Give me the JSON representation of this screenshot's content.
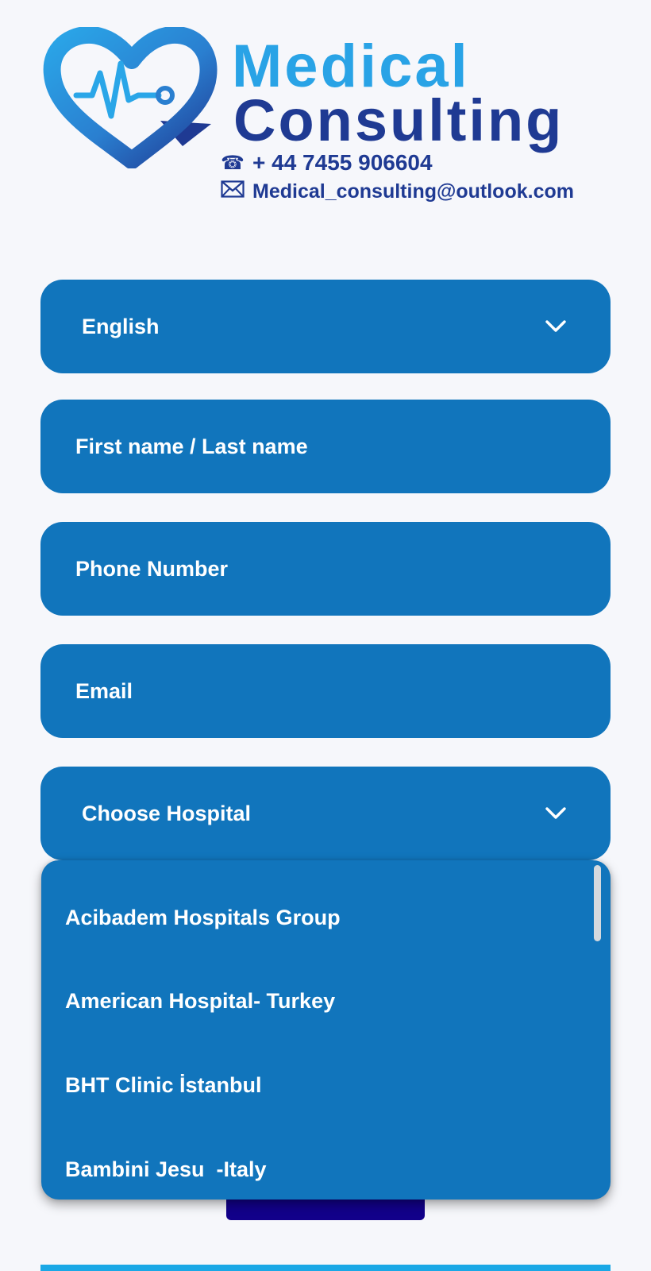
{
  "brand": {
    "name_line1": "Medical",
    "name_line2": "Consulting",
    "phone": "+ 44 7455 906604",
    "email": "Medical_consulting@outlook.com",
    "colors": {
      "light_blue": "#29a3e6",
      "dark_blue": "#1f3a93"
    }
  },
  "form": {
    "language_select": {
      "value": "English",
      "icon": "chevron-down-icon"
    },
    "name_field": {
      "placeholder": "First name / Last name"
    },
    "phone_field": {
      "placeholder": "Phone Number"
    },
    "email_field": {
      "placeholder": "Email"
    },
    "hospital_select": {
      "value": "Choose Hospital",
      "icon": "chevron-down-icon"
    },
    "field_color": "#1175bc",
    "submit_color": "#12008a"
  },
  "hospital_dropdown": {
    "options": [
      "Acibadem Hospitals Group",
      "American Hospital- Turkey",
      "BHT Clinic İstanbul",
      "Bambini Jesu  -Italy"
    ]
  }
}
